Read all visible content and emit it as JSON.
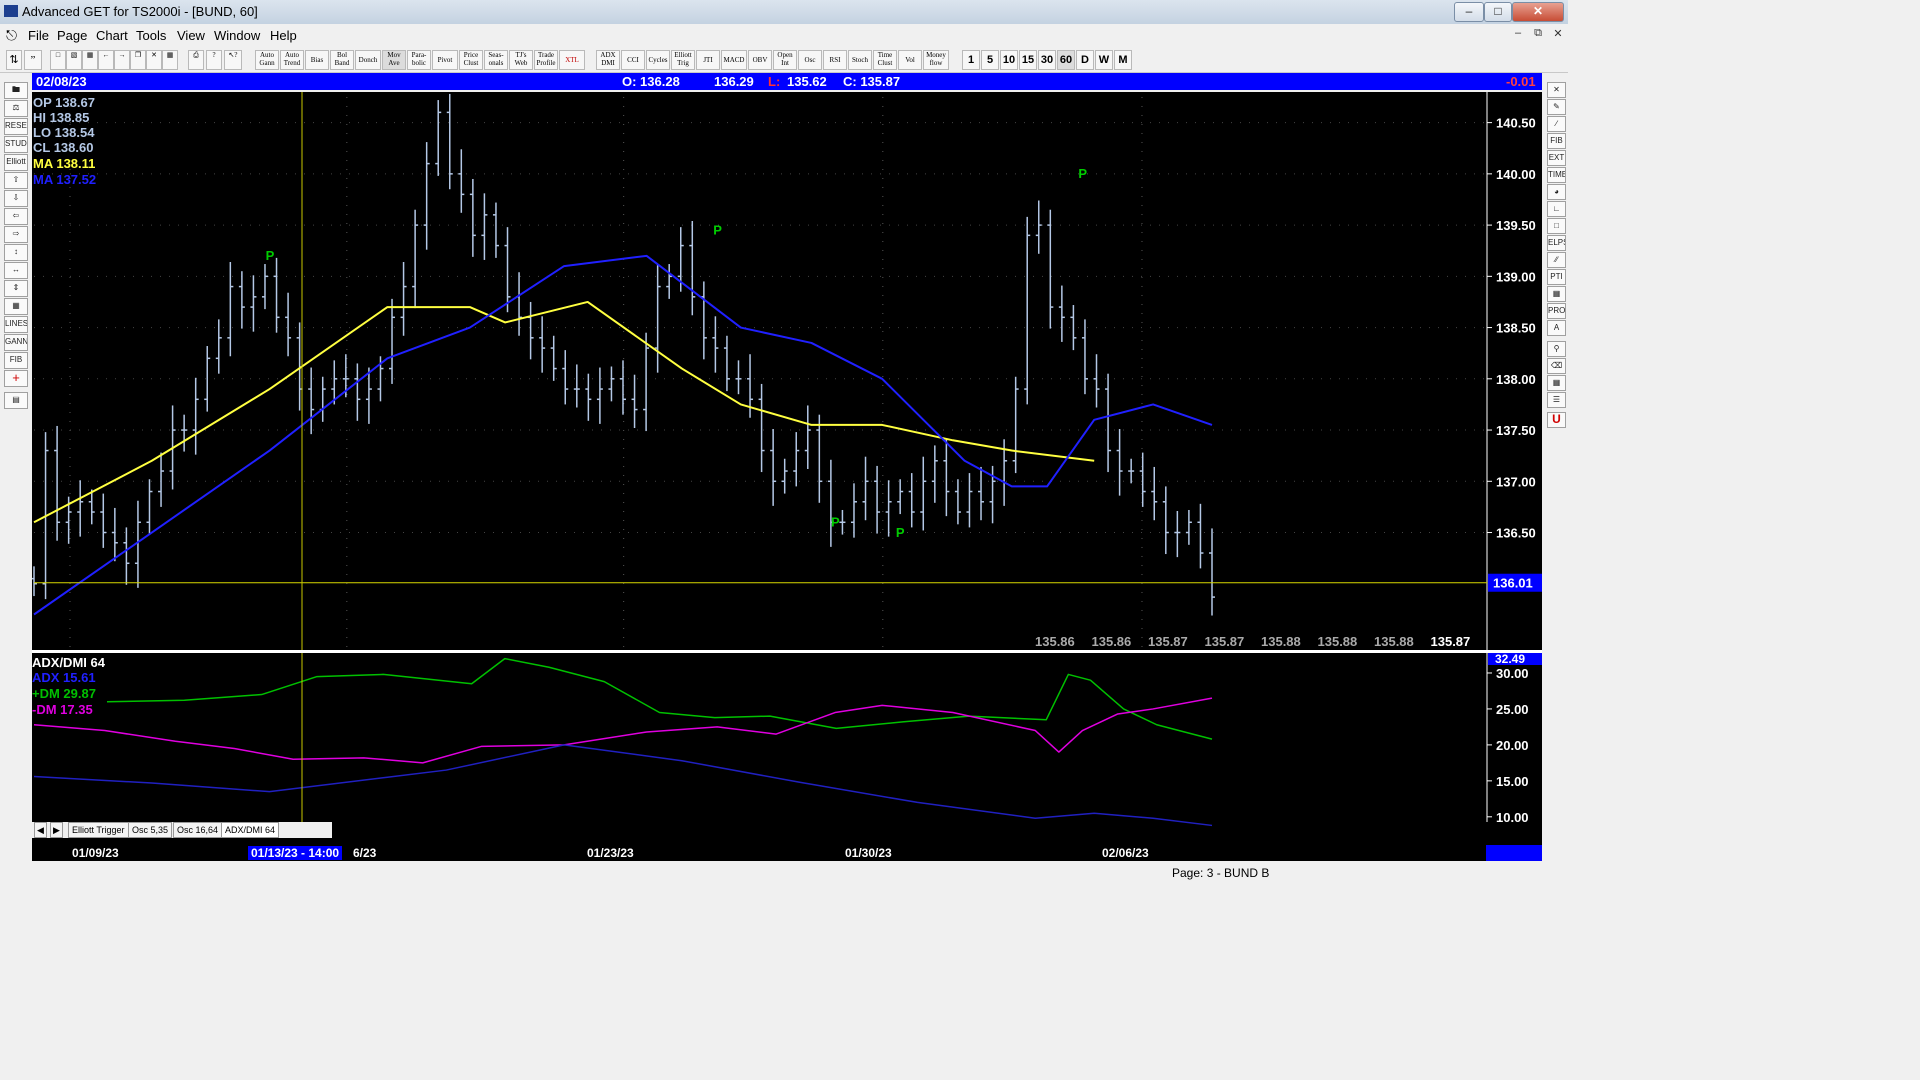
{
  "window": {
    "title": "Advanced GET for TS2000i - [BUND, 60]",
    "controls": [
      "minimize",
      "maximize",
      "close"
    ]
  },
  "menu": {
    "items": [
      "File",
      "Page",
      "Chart",
      "Tools",
      "View",
      "Window",
      "Help"
    ]
  },
  "toolbar": {
    "buttons": [
      "Auto Gann",
      "Auto Trend",
      "Bias",
      "Bol Band",
      "Donch",
      "Mov Ave",
      "Para- bolic",
      "Pivot",
      "Price Clust",
      "Seas- onals",
      "TJ's Web",
      "Trade Profile",
      "XTL",
      "ADX DMI",
      "CCI",
      "Cycles",
      "Elliott Trig",
      "JTI",
      "MACD",
      "OBV",
      "Open Int",
      "Osc",
      "RSI",
      "Stoch",
      "Time Clust",
      "Vol",
      "Money flow"
    ],
    "intervals": [
      "1",
      "5",
      "10",
      "15",
      "30",
      "60",
      "D",
      "W",
      "M"
    ]
  },
  "status_row": {
    "date": "02/08/23",
    "open": "O: 136.28",
    "high": "136.29",
    "low_label": "L:",
    "low": "135.62",
    "close": "C: 135.87",
    "change": "-0.01"
  },
  "info_box": {
    "op": "OP  138.67",
    "hi": "HI   138.85",
    "lo": "LO  138.54",
    "cl": "CL  138.60",
    "ma1": "MA  138.11",
    "ma2": "MA  137.52"
  },
  "price_axis": {
    "ticks": [
      "140.50",
      "140.00",
      "139.50",
      "139.00",
      "138.50",
      "138.00",
      "137.50",
      "137.00",
      "136.50"
    ],
    "current": "136.01"
  },
  "bottom_price_readout": [
    "135.86",
    "135.86",
    "135.87",
    "135.87",
    "135.88",
    "135.88",
    "135.88",
    "135.87"
  ],
  "indicator": {
    "title": "ADX/DMI 64",
    "adx": "ADX 15.61",
    "plus_dm": "+DM 29.87",
    "minus_dm": "-DM  17.35",
    "axis_top": "32.49",
    "ticks": [
      "30.00",
      "25.00",
      "20.00",
      "15.00",
      "10.00"
    ]
  },
  "tabs": [
    "Elliott Trigger",
    "Osc 5,35",
    "Osc 16,64",
    "ADX/DMI 64"
  ],
  "date_axis": {
    "labels": [
      "01/09/23",
      "6/23",
      "01/23/23",
      "01/30/23",
      "02/06/23"
    ],
    "cursor": "01/13/23 - 14:00"
  },
  "footer": {
    "page": "Page: 3 - BUND B"
  },
  "colors": {
    "price_bars": "#b4c8e6",
    "ma_fast": "#ffff40",
    "ma_slow": "#2020ff",
    "pivot": "#00cc00",
    "plus_dm": "#00c000",
    "minus_dm": "#e000e0",
    "adx": "#2020c0"
  },
  "chart_data": {
    "type": "line",
    "title": "",
    "ylim": [
      135.5,
      140.75
    ],
    "pivots": [
      {
        "label": "P",
        "x": 0.2,
        "y": 139.1
      },
      {
        "label": "P",
        "x": 0.58,
        "y": 139.35
      },
      {
        "label": "P",
        "x": 0.68,
        "y": 136.5
      },
      {
        "label": "P",
        "x": 0.89,
        "y": 139.9
      },
      {
        "label": "P",
        "x": 0.735,
        "y": 136.4
      }
    ],
    "series": [
      {
        "name": "MA 138.11",
        "x": [
          0.0,
          0.1,
          0.2,
          0.3,
          0.37,
          0.4,
          0.47,
          0.55,
          0.6,
          0.66,
          0.72,
          0.78,
          0.83,
          0.9
        ],
        "values": [
          136.6,
          137.2,
          137.9,
          138.7,
          138.7,
          138.55,
          138.75,
          138.1,
          137.75,
          137.55,
          137.55,
          137.4,
          137.3,
          137.2
        ]
      },
      {
        "name": "MA 137.52",
        "x": [
          0.0,
          0.1,
          0.2,
          0.3,
          0.37,
          0.45,
          0.52,
          0.6,
          0.66,
          0.72,
          0.79,
          0.83,
          0.86,
          0.9,
          0.95,
          1.0
        ],
        "values": [
          135.7,
          136.5,
          137.3,
          138.2,
          138.5,
          139.1,
          139.2,
          138.5,
          138.35,
          138.0,
          137.2,
          136.95,
          136.95,
          137.6,
          137.75,
          137.55
        ]
      }
    ],
    "close_series": [
      136.0,
      137.3,
      136.6,
      136.7,
      136.8,
      136.7,
      136.5,
      136.4,
      136.2,
      136.6,
      136.9,
      137.1,
      137.5,
      137.5,
      137.8,
      138.2,
      138.4,
      138.9,
      138.7,
      138.8,
      139.0,
      138.6,
      138.4,
      137.9,
      137.7,
      137.9,
      138.0,
      138.0,
      137.8,
      137.9,
      138.1,
      138.6,
      138.9,
      139.5,
      140.1,
      140.6,
      140.0,
      139.8,
      139.4,
      139.6,
      139.3,
      138.8,
      138.6,
      138.4,
      138.3,
      138.1,
      137.9,
      137.9,
      137.8,
      137.9,
      138.0,
      137.8,
      137.7,
      138.3,
      138.9,
      139.0,
      139.3,
      138.8,
      138.4,
      138.3,
      138.0,
      138.0,
      137.8,
      137.3,
      137.0,
      137.1,
      137.3,
      137.5,
      137.0,
      136.6,
      136.6,
      136.8,
      137.0,
      136.7,
      136.8,
      136.9,
      136.7,
      137.0,
      137.2,
      136.9,
      136.7,
      136.9,
      136.8,
      137.0,
      137.2,
      137.9,
      139.4,
      139.5,
      138.7,
      138.6,
      138.4,
      138.0,
      137.9,
      137.3,
      137.1,
      137.1,
      136.9,
      136.8,
      136.5,
      136.5,
      136.6,
      136.3,
      135.87
    ],
    "adx_panel": {
      "ylim": [
        9,
        32.5
      ],
      "series": [
        {
          "name": "+DM 29.87",
          "x": [
            0.0,
            0.07,
            0.14,
            0.19,
            0.25,
            0.33,
            0.36,
            0.4,
            0.45,
            0.5,
            0.55,
            0.6,
            0.66,
            0.72,
            0.78,
            0.85,
            0.87,
            0.89,
            0.92,
            0.95,
            1.0
          ],
          "values": [
            26.0,
            26.2,
            27.0,
            29.5,
            29.8,
            28.5,
            32.0,
            30.8,
            28.8,
            24.5,
            23.8,
            24.0,
            22.3,
            23.2,
            24.0,
            23.5,
            29.8,
            29.0,
            25.0,
            22.8,
            20.8
          ]
        },
        {
          "name": "-DM  17.35",
          "x": [
            0.0,
            0.06,
            0.12,
            0.17,
            0.22,
            0.28,
            0.33,
            0.38,
            0.45,
            0.52,
            0.58,
            0.63,
            0.68,
            0.72,
            0.78,
            0.85,
            0.87,
            0.89,
            0.92,
            0.95,
            1.0
          ],
          "values": [
            22.8,
            22.0,
            20.5,
            19.5,
            18.0,
            18.2,
            17.5,
            19.8,
            20.0,
            21.8,
            22.5,
            21.5,
            24.5,
            25.5,
            24.5,
            22.0,
            19.0,
            22.0,
            24.3,
            25.0,
            26.5
          ]
        },
        {
          "name": "ADX 15.61",
          "x": [
            0.0,
            0.1,
            0.2,
            0.3,
            0.35,
            0.45,
            0.55,
            0.65,
            0.75,
            0.85,
            0.9,
            0.95,
            1.0
          ],
          "values": [
            15.6,
            14.7,
            13.5,
            15.5,
            16.5,
            20.0,
            17.8,
            14.8,
            12.0,
            9.8,
            10.5,
            9.8,
            8.8
          ]
        }
      ]
    }
  }
}
